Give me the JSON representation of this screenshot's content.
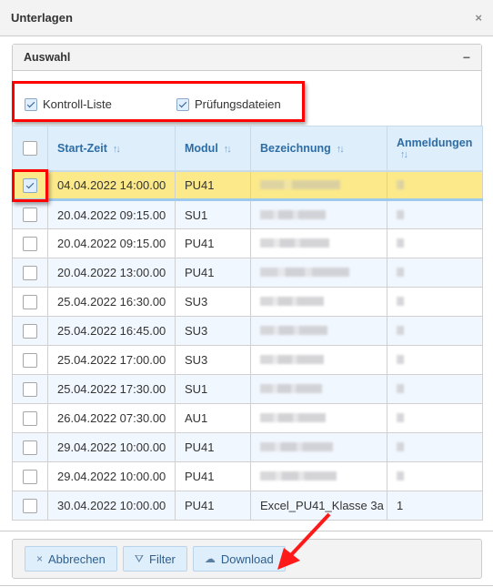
{
  "dialog": {
    "title": "Unterlagen",
    "close_icon": "×"
  },
  "panel": {
    "title": "Auswahl",
    "collapse_icon": "−"
  },
  "options": [
    {
      "label": "Kontroll-Liste",
      "checked": true
    },
    {
      "label": "Prüfungsdateien",
      "checked": true
    }
  ],
  "table": {
    "headers": {
      "start": "Start-Zeit",
      "modul": "Modul",
      "bezeichnung": "Bezeichnung",
      "anmeldungen": "Anmeldungen",
      "sort_icon": "↑↓"
    },
    "rows": [
      {
        "checked": true,
        "start": "04.04.2022 14:00.00",
        "modul": "PU41",
        "bezeichnung": "[blurred]",
        "anmeldungen": "[blurred]"
      },
      {
        "checked": false,
        "start": "20.04.2022 09:15.00",
        "modul": "SU1",
        "bezeichnung": "[blurred]",
        "anmeldungen": "[blurred]"
      },
      {
        "checked": false,
        "start": "20.04.2022 09:15.00",
        "modul": "PU41",
        "bezeichnung": "[blurred]",
        "anmeldungen": "[blurred]"
      },
      {
        "checked": false,
        "start": "20.04.2022 13:00.00",
        "modul": "PU41",
        "bezeichnung": "[blurred]",
        "anmeldungen": "[blurred]"
      },
      {
        "checked": false,
        "start": "25.04.2022 16:30.00",
        "modul": "SU3",
        "bezeichnung": "[blurred]",
        "anmeldungen": "[blurred]"
      },
      {
        "checked": false,
        "start": "25.04.2022 16:45.00",
        "modul": "SU3",
        "bezeichnung": "[blurred]",
        "anmeldungen": "[blurred]"
      },
      {
        "checked": false,
        "start": "25.04.2022 17:00.00",
        "modul": "SU3",
        "bezeichnung": "[blurred]",
        "anmeldungen": "[blurred]"
      },
      {
        "checked": false,
        "start": "25.04.2022 17:30.00",
        "modul": "SU1",
        "bezeichnung": "[blurred]",
        "anmeldungen": "[blurred]"
      },
      {
        "checked": false,
        "start": "26.04.2022 07:30.00",
        "modul": "AU1",
        "bezeichnung": "[blurred]",
        "anmeldungen": "[blurred]"
      },
      {
        "checked": false,
        "start": "29.04.2022 10:00.00",
        "modul": "PU41",
        "bezeichnung": "[blurred]",
        "anmeldungen": "[blurred]"
      },
      {
        "checked": false,
        "start": "29.04.2022 10:00.00",
        "modul": "PU41",
        "bezeichnung": "[blurred]",
        "anmeldungen": "[blurred]"
      },
      {
        "checked": false,
        "start": "30.04.2022 10:00.00",
        "modul": "PU41",
        "bezeichnung": "Excel_PU41_Klasse 3a",
        "anmeldungen": "1"
      }
    ]
  },
  "footer": {
    "buttons": [
      {
        "label": "Abbrechen",
        "icon": "×"
      },
      {
        "label": "Filter",
        "icon": "⛛"
      },
      {
        "label": "Download",
        "icon": "☁"
      }
    ]
  },
  "colors": {
    "accent": "#2e6da4",
    "selected_row": "#fbe98a",
    "highlight": "#ff0000"
  }
}
